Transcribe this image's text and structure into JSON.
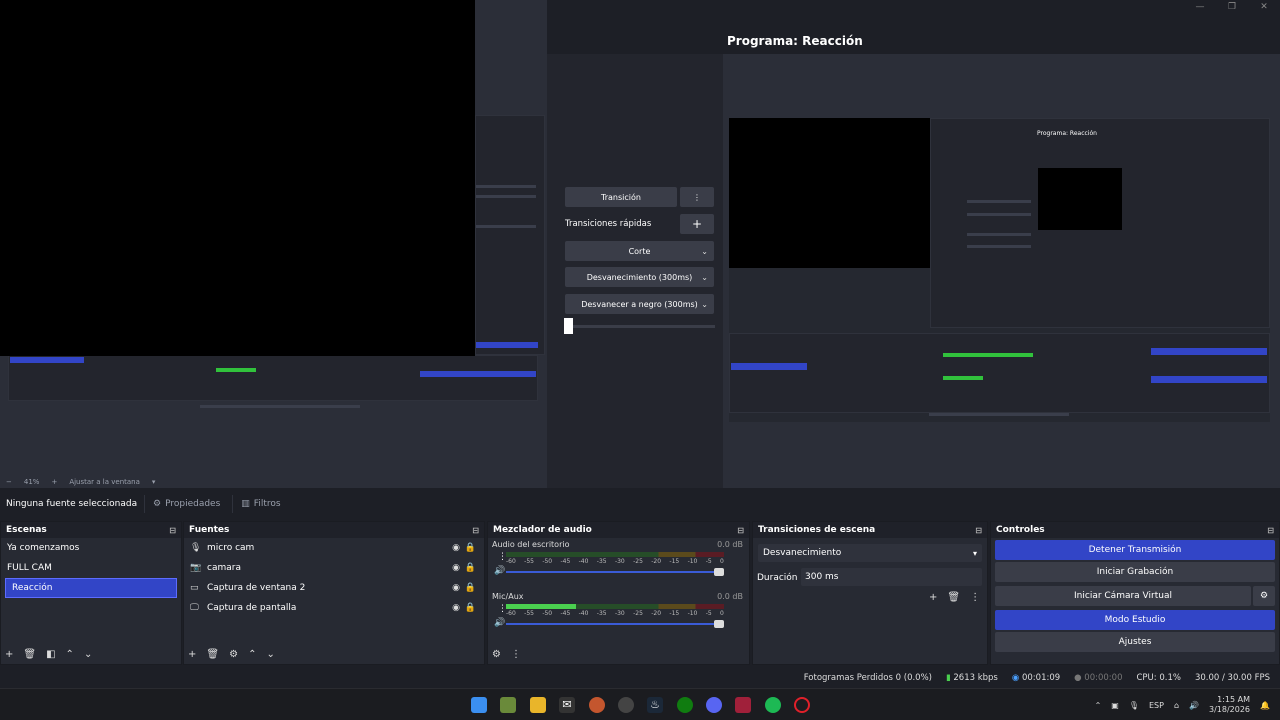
{
  "window": {
    "controls": [
      "—",
      "❐",
      "✕"
    ]
  },
  "preview": {
    "zoom": "41%",
    "fit_label": "Ajustar a la ventana"
  },
  "program": {
    "title": "Programa: Reacción"
  },
  "transitions_panel": {
    "transition_btn": "Transición",
    "quick_label": "Transiciones rápidas",
    "quick_items": [
      "Corte",
      "Desvanecimiento (300ms)",
      "Desvanecer a negro (300ms)"
    ]
  },
  "source_bar": {
    "no_selection": "Ninguna fuente seleccionada",
    "properties": "Propiedades",
    "filters": "Filtros"
  },
  "scenes": {
    "title": "Escenas",
    "items": [
      "Ya comenzamos",
      "FULL CAM",
      "Reacción"
    ],
    "selected": 2
  },
  "sources": {
    "title": "Fuentes",
    "items": [
      {
        "name": "micro cam",
        "icon": "mic-icon"
      },
      {
        "name": "camara",
        "icon": "camera-icon"
      },
      {
        "name": "Captura de ventana 2",
        "icon": "window-icon"
      },
      {
        "name": "Captura de pantalla",
        "icon": "monitor-icon"
      }
    ]
  },
  "mixer": {
    "title": "Mezclador de audio",
    "scale": [
      "-60",
      "-55",
      "-50",
      "-45",
      "-40",
      "-35",
      "-30",
      "-25",
      "-20",
      "-15",
      "-10",
      "-5",
      "0"
    ],
    "channels": [
      {
        "name": "Audio del escritorio",
        "db": "0.0 dB",
        "level": 0.0,
        "volume": 1.0
      },
      {
        "name": "Mic/Aux",
        "db": "0.0 dB",
        "level": 0.32,
        "volume": 1.0
      }
    ]
  },
  "scene_transitions": {
    "title": "Transiciones de escena",
    "selected": "Desvanecimiento",
    "duration_label": "Duración",
    "duration_value": "300 ms"
  },
  "controls": {
    "title": "Controles",
    "buttons": [
      {
        "label": "Detener Transmisión",
        "active": true
      },
      {
        "label": "Iniciar Grabación",
        "active": false
      },
      {
        "label": "Iniciar Cámara Virtual",
        "active": false
      },
      {
        "label": "Modo Estudio",
        "active": true
      },
      {
        "label": "Ajustes",
        "active": false
      }
    ]
  },
  "status": {
    "dropped": "Fotogramas Perdidos 0 (0.0%)",
    "bitrate": "2613 kbps",
    "stream_time": "00:01:09",
    "rec_time": "00:00:00",
    "cpu": "CPU: 0.1%",
    "fps": "30.00 / 30.00 FPS"
  },
  "taskbar": {
    "lang": "ESP",
    "time": "1:15 AM",
    "date": "3/18/2026"
  }
}
